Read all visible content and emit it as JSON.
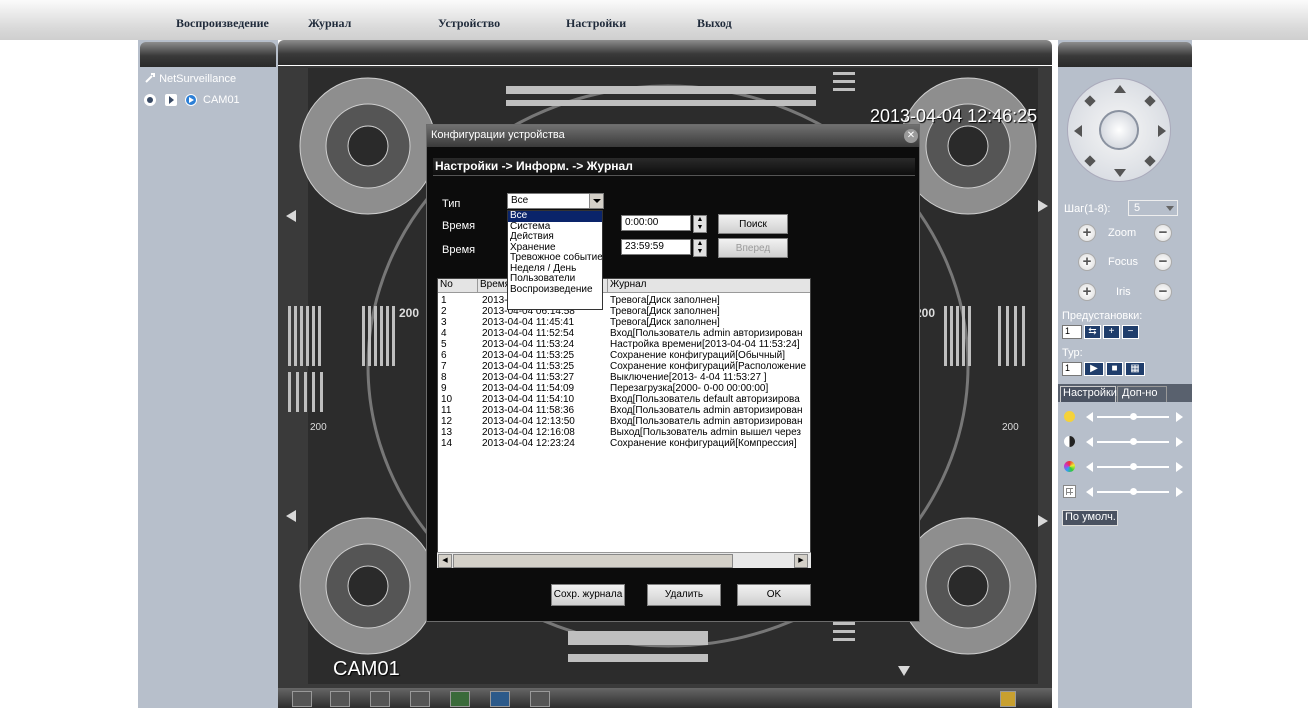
{
  "menu": [
    "Воспроизведение",
    "Журнал",
    "Устройство",
    "Настройки",
    "Выход"
  ],
  "tree": {
    "root": "NetSurveillance",
    "camera": "CAM01"
  },
  "video": {
    "timestamp": "2013-04-04 12:46:25",
    "channel": "CAM01",
    "chart_numbers": [
      "200",
      "200",
      "200",
      "200"
    ]
  },
  "dialog": {
    "title": "Конфигурации устройства",
    "breadcrumb": "Настройки -> Информ. -> Журнал",
    "type_label": "Тип",
    "type_value": "Все",
    "time_label_1": "Время",
    "time_label_2": "Время",
    "start_time": "0:00:00",
    "end_time": "23:59:59",
    "search_button": "Поиск",
    "forward_button": "Вперед",
    "type_options": [
      "Все",
      "Система",
      "Действия",
      "Хранение",
      "Тревожное событие",
      "Неделя / День",
      "Пользователи",
      "Воспроизведение"
    ],
    "columns": [
      "No",
      "Время",
      "Журнал"
    ],
    "rows": [
      {
        "no": "1",
        "time": "2013-04-04 06:14:58",
        "log": "Тревога[Диск заполнен]"
      },
      {
        "no": "2",
        "time": "2013-04-04 06:14:58",
        "log": "Тревога[Диск заполнен]"
      },
      {
        "no": "3",
        "time": "2013-04-04 11:45:41",
        "log": "Тревога[Диск заполнен]"
      },
      {
        "no": "4",
        "time": "2013-04-04 11:52:54",
        "log": "Вход[Пользователь admin авторизирован"
      },
      {
        "no": "5",
        "time": "2013-04-04 11:53:24",
        "log": "Настройка времени[2013-04-04 11:53:24]"
      },
      {
        "no": "6",
        "time": "2013-04-04 11:53:25",
        "log": "Сохранение конфигураций[Обычный]"
      },
      {
        "no": "7",
        "time": "2013-04-04 11:53:25",
        "log": "Сохранение конфигураций[Расположение"
      },
      {
        "no": "8",
        "time": "2013-04-04 11:53:27",
        "log": "Выключение[2013- 4-04 11:53:27 ]"
      },
      {
        "no": "9",
        "time": "2013-04-04 11:54:09",
        "log": "Перезагрузка[2000- 0-00 00:00:00]"
      },
      {
        "no": "10",
        "time": "2013-04-04 11:54:10",
        "log": "Вход[Пользователь default авторизирова"
      },
      {
        "no": "11",
        "time": "2013-04-04 11:58:36",
        "log": "Вход[Пользователь admin авторизирован"
      },
      {
        "no": "12",
        "time": "2013-04-04 12:13:50",
        "log": "Вход[Пользователь admin авторизирован"
      },
      {
        "no": "13",
        "time": "2013-04-04 12:16:08",
        "log": "Выход[Пользователь admin вышел через"
      },
      {
        "no": "14",
        "time": "2013-04-04 12:23:24",
        "log": "Сохранение конфигураций[Компрессия]"
      }
    ],
    "save_log_button": "Сохр. журнала",
    "delete_button": "Удалить",
    "ok_button": "OK"
  },
  "ptz": {
    "step_label": "Шаг(1-8):",
    "step_value": "5",
    "zoom": "Zoom",
    "focus": "Focus",
    "iris": "Iris",
    "presets_label": "Предустановки:",
    "preset_value": "1",
    "tour_label": "Тур:",
    "tour_value": "1"
  },
  "tabs": [
    "Настройки",
    "Доп-но"
  ],
  "default_button": "По умолч."
}
